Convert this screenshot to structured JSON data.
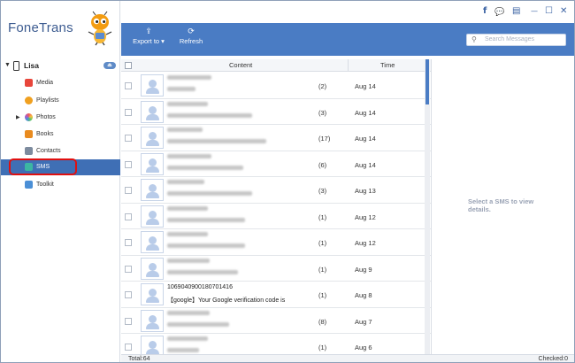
{
  "app": {
    "title": "FoneTrans"
  },
  "window_controls": {
    "facebook": "f",
    "chat": "💬",
    "feedback": "▤",
    "minimize": "—",
    "maximize": "☐",
    "close": "✕"
  },
  "sidebar": {
    "device_name": "Lisa",
    "items": [
      {
        "label": "Media",
        "color": "#e8463b"
      },
      {
        "label": "Playlists",
        "color": "#f0a020"
      },
      {
        "label": "Photos",
        "color": "#e85a7a"
      },
      {
        "label": "Books",
        "color": "#e98b1f"
      },
      {
        "label": "Contacts",
        "color": "#7d8b9e"
      },
      {
        "label": "SMS",
        "color": "#3cb6a2"
      },
      {
        "label": "Toolkit",
        "color": "#4b8fd6"
      }
    ],
    "active_item": "SMS"
  },
  "toolbar": {
    "export_label": "Export to",
    "refresh_label": "Refresh",
    "search_placeholder": "Search Messages"
  },
  "table": {
    "col_content": "Content",
    "col_time": "Time",
    "rows": [
      {
        "count": "(2)",
        "time": "Aug 14"
      },
      {
        "count": "(3)",
        "time": "Aug 14"
      },
      {
        "count": "(17)",
        "time": "Aug 14"
      },
      {
        "count": "(6)",
        "time": "Aug 14"
      },
      {
        "count": "(3)",
        "time": "Aug 13"
      },
      {
        "count": "(1)",
        "time": "Aug 12"
      },
      {
        "count": "(1)",
        "time": "Aug 12"
      },
      {
        "count": "(1)",
        "time": "Aug 9"
      },
      {
        "line1": "1069040900180701416",
        "line2": "【google】Your Google verification code is",
        "count": "(1)",
        "time": "Aug 8"
      },
      {
        "count": "(8)",
        "time": "Aug 7"
      },
      {
        "count": "(1)",
        "time": "Aug 6"
      }
    ]
  },
  "detail": {
    "hint": "Select a SMS to view details."
  },
  "status": {
    "total": "Total:64",
    "checked": "Checked:0"
  },
  "colors": {
    "accent": "#4a7cc4",
    "highlight": "#e01010"
  }
}
